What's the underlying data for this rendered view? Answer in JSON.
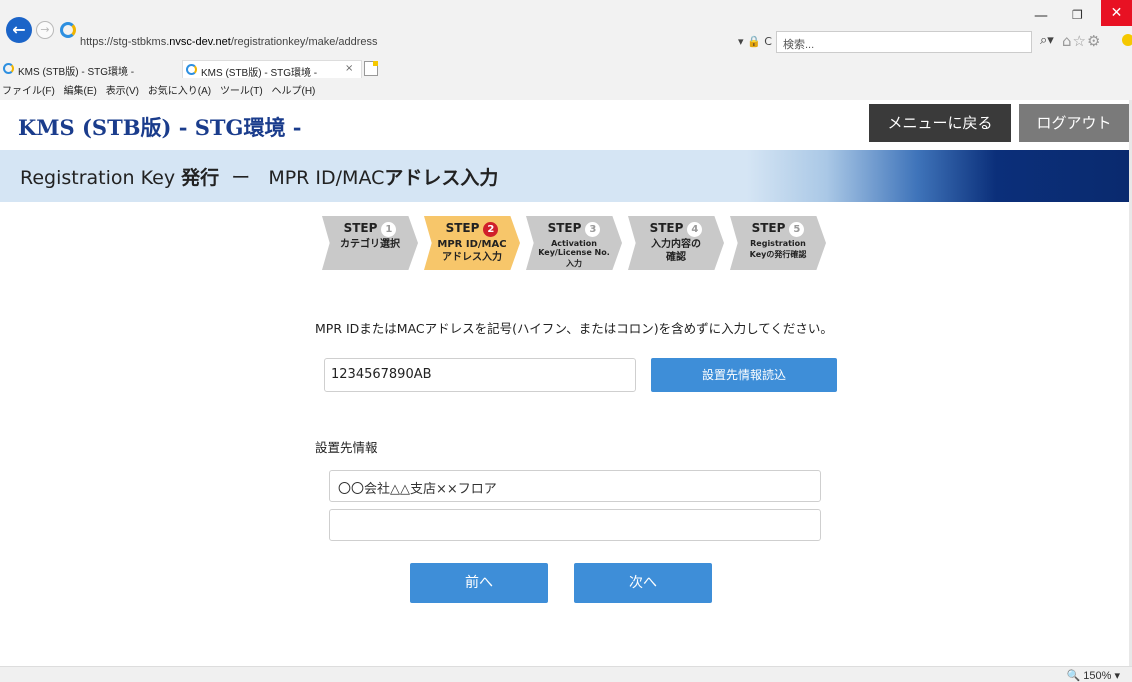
{
  "browser": {
    "url_prefix": "https://stg-stbkms.",
    "url_domain": "nvsc-dev.net",
    "url_path": "/registrationkey/make/address",
    "addr_tools": "▾ 🔒 C",
    "search_placeholder": "検索...",
    "tabs": [
      {
        "label": "KMS (STB版)  - STG環境 -"
      },
      {
        "label": "KMS (STB版)  - STG環境 -"
      }
    ],
    "tab_close": "×",
    "menu": [
      "ファイル(F)",
      "編集(E)",
      "表示(V)",
      "お気に入り(A)",
      "ツール(T)",
      "ヘルプ(H)"
    ],
    "zoom": "150%"
  },
  "header": {
    "title": "KMS (STB版)  - STG環境 -",
    "menu_button": "メニューに戻る",
    "logout_button": "ログアウト"
  },
  "subheader": {
    "title_prefix": "Registration Key ",
    "title_bold1": "発行",
    "title_dash": "  ー   ",
    "title_mid": "MPR ID/MAC",
    "title_bold2": "アドレス入力"
  },
  "steps": [
    {
      "head": "STEP",
      "num": "1",
      "label1": "カテゴリ選択",
      "label2": ""
    },
    {
      "head": "STEP",
      "num": "2",
      "label1": "MPR ID/MAC",
      "label2": "アドレス入力"
    },
    {
      "head": "STEP",
      "num": "3",
      "label1": "Activation Key/License No.",
      "label2": "入力"
    },
    {
      "head": "STEP",
      "num": "4",
      "label1": "入力内容の",
      "label2": "確認"
    },
    {
      "head": "STEP",
      "num": "5",
      "label1": "Registration",
      "label2": "Keyの発行確認"
    }
  ],
  "form": {
    "instruction": "MPR IDまたはMACアドレスを記号(ハイフン、またはコロン)を含めずに入力してください。",
    "mac_value": "1234567890AB",
    "read_button": "設置先情報読込",
    "section_label": "設置先情報",
    "address_line1": "〇〇会社△△支店××フロア",
    "address_line2": "",
    "prev_button": "前へ",
    "next_button": "次へ"
  }
}
